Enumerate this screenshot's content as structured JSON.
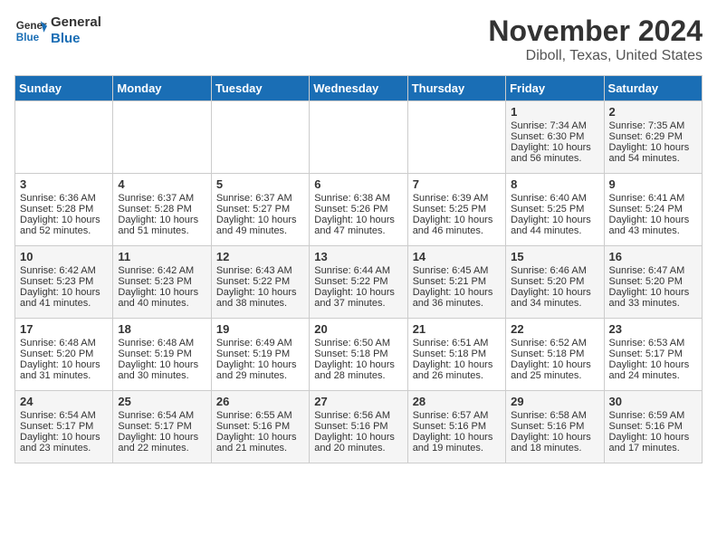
{
  "header": {
    "logo_line1": "General",
    "logo_line2": "Blue",
    "month": "November 2024",
    "location": "Diboll, Texas, United States"
  },
  "days_of_week": [
    "Sunday",
    "Monday",
    "Tuesday",
    "Wednesday",
    "Thursday",
    "Friday",
    "Saturday"
  ],
  "weeks": [
    [
      {
        "day": "",
        "sunrise": "",
        "sunset": "",
        "daylight": ""
      },
      {
        "day": "",
        "sunrise": "",
        "sunset": "",
        "daylight": ""
      },
      {
        "day": "",
        "sunrise": "",
        "sunset": "",
        "daylight": ""
      },
      {
        "day": "",
        "sunrise": "",
        "sunset": "",
        "daylight": ""
      },
      {
        "day": "",
        "sunrise": "",
        "sunset": "",
        "daylight": ""
      },
      {
        "day": "1",
        "sunrise": "Sunrise: 7:34 AM",
        "sunset": "Sunset: 6:30 PM",
        "daylight": "Daylight: 10 hours and 56 minutes."
      },
      {
        "day": "2",
        "sunrise": "Sunrise: 7:35 AM",
        "sunset": "Sunset: 6:29 PM",
        "daylight": "Daylight: 10 hours and 54 minutes."
      }
    ],
    [
      {
        "day": "3",
        "sunrise": "Sunrise: 6:36 AM",
        "sunset": "Sunset: 5:28 PM",
        "daylight": "Daylight: 10 hours and 52 minutes."
      },
      {
        "day": "4",
        "sunrise": "Sunrise: 6:37 AM",
        "sunset": "Sunset: 5:28 PM",
        "daylight": "Daylight: 10 hours and 51 minutes."
      },
      {
        "day": "5",
        "sunrise": "Sunrise: 6:37 AM",
        "sunset": "Sunset: 5:27 PM",
        "daylight": "Daylight: 10 hours and 49 minutes."
      },
      {
        "day": "6",
        "sunrise": "Sunrise: 6:38 AM",
        "sunset": "Sunset: 5:26 PM",
        "daylight": "Daylight: 10 hours and 47 minutes."
      },
      {
        "day": "7",
        "sunrise": "Sunrise: 6:39 AM",
        "sunset": "Sunset: 5:25 PM",
        "daylight": "Daylight: 10 hours and 46 minutes."
      },
      {
        "day": "8",
        "sunrise": "Sunrise: 6:40 AM",
        "sunset": "Sunset: 5:25 PM",
        "daylight": "Daylight: 10 hours and 44 minutes."
      },
      {
        "day": "9",
        "sunrise": "Sunrise: 6:41 AM",
        "sunset": "Sunset: 5:24 PM",
        "daylight": "Daylight: 10 hours and 43 minutes."
      }
    ],
    [
      {
        "day": "10",
        "sunrise": "Sunrise: 6:42 AM",
        "sunset": "Sunset: 5:23 PM",
        "daylight": "Daylight: 10 hours and 41 minutes."
      },
      {
        "day": "11",
        "sunrise": "Sunrise: 6:42 AM",
        "sunset": "Sunset: 5:23 PM",
        "daylight": "Daylight: 10 hours and 40 minutes."
      },
      {
        "day": "12",
        "sunrise": "Sunrise: 6:43 AM",
        "sunset": "Sunset: 5:22 PM",
        "daylight": "Daylight: 10 hours and 38 minutes."
      },
      {
        "day": "13",
        "sunrise": "Sunrise: 6:44 AM",
        "sunset": "Sunset: 5:22 PM",
        "daylight": "Daylight: 10 hours and 37 minutes."
      },
      {
        "day": "14",
        "sunrise": "Sunrise: 6:45 AM",
        "sunset": "Sunset: 5:21 PM",
        "daylight": "Daylight: 10 hours and 36 minutes."
      },
      {
        "day": "15",
        "sunrise": "Sunrise: 6:46 AM",
        "sunset": "Sunset: 5:20 PM",
        "daylight": "Daylight: 10 hours and 34 minutes."
      },
      {
        "day": "16",
        "sunrise": "Sunrise: 6:47 AM",
        "sunset": "Sunset: 5:20 PM",
        "daylight": "Daylight: 10 hours and 33 minutes."
      }
    ],
    [
      {
        "day": "17",
        "sunrise": "Sunrise: 6:48 AM",
        "sunset": "Sunset: 5:20 PM",
        "daylight": "Daylight: 10 hours and 31 minutes."
      },
      {
        "day": "18",
        "sunrise": "Sunrise: 6:48 AM",
        "sunset": "Sunset: 5:19 PM",
        "daylight": "Daylight: 10 hours and 30 minutes."
      },
      {
        "day": "19",
        "sunrise": "Sunrise: 6:49 AM",
        "sunset": "Sunset: 5:19 PM",
        "daylight": "Daylight: 10 hours and 29 minutes."
      },
      {
        "day": "20",
        "sunrise": "Sunrise: 6:50 AM",
        "sunset": "Sunset: 5:18 PM",
        "daylight": "Daylight: 10 hours and 28 minutes."
      },
      {
        "day": "21",
        "sunrise": "Sunrise: 6:51 AM",
        "sunset": "Sunset: 5:18 PM",
        "daylight": "Daylight: 10 hours and 26 minutes."
      },
      {
        "day": "22",
        "sunrise": "Sunrise: 6:52 AM",
        "sunset": "Sunset: 5:18 PM",
        "daylight": "Daylight: 10 hours and 25 minutes."
      },
      {
        "day": "23",
        "sunrise": "Sunrise: 6:53 AM",
        "sunset": "Sunset: 5:17 PM",
        "daylight": "Daylight: 10 hours and 24 minutes."
      }
    ],
    [
      {
        "day": "24",
        "sunrise": "Sunrise: 6:54 AM",
        "sunset": "Sunset: 5:17 PM",
        "daylight": "Daylight: 10 hours and 23 minutes."
      },
      {
        "day": "25",
        "sunrise": "Sunrise: 6:54 AM",
        "sunset": "Sunset: 5:17 PM",
        "daylight": "Daylight: 10 hours and 22 minutes."
      },
      {
        "day": "26",
        "sunrise": "Sunrise: 6:55 AM",
        "sunset": "Sunset: 5:16 PM",
        "daylight": "Daylight: 10 hours and 21 minutes."
      },
      {
        "day": "27",
        "sunrise": "Sunrise: 6:56 AM",
        "sunset": "Sunset: 5:16 PM",
        "daylight": "Daylight: 10 hours and 20 minutes."
      },
      {
        "day": "28",
        "sunrise": "Sunrise: 6:57 AM",
        "sunset": "Sunset: 5:16 PM",
        "daylight": "Daylight: 10 hours and 19 minutes."
      },
      {
        "day": "29",
        "sunrise": "Sunrise: 6:58 AM",
        "sunset": "Sunset: 5:16 PM",
        "daylight": "Daylight: 10 hours and 18 minutes."
      },
      {
        "day": "30",
        "sunrise": "Sunrise: 6:59 AM",
        "sunset": "Sunset: 5:16 PM",
        "daylight": "Daylight: 10 hours and 17 minutes."
      }
    ]
  ]
}
